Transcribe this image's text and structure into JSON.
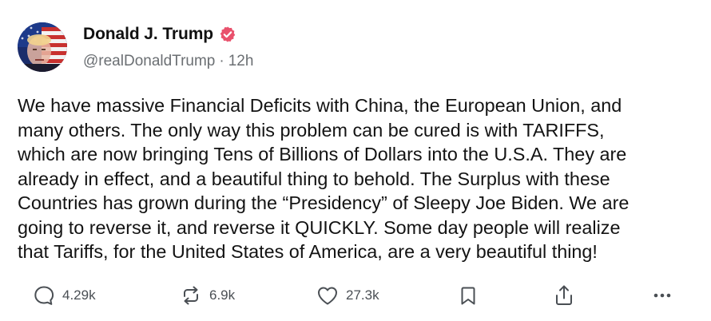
{
  "post": {
    "author": {
      "display_name": "Donald J. Trump",
      "handle": "@realDonaldTrump",
      "separator": "·",
      "time_ago": "12h",
      "verified": true
    },
    "text": "We have massive Financial Deficits with China, the European Union, and\nmany others. The only way this problem can be cured is with TARIFFS,\nwhich are now bringing Tens of Billions of Dollars into the U.S.A. They are\nalready in effect, and a beautiful thing to behold. The Surplus with these\nCountries has grown during the “Presidency” of Sleepy Joe Biden. We are\ngoing to reverse it, and reverse it QUICKLY. Some day people will realize\nthat Tariffs, for the United States of America, are a very beautiful thing!",
    "actions": {
      "replies": {
        "icon": "reply-icon",
        "count": "4.29k"
      },
      "reposts": {
        "icon": "repost-icon",
        "count": "6.9k"
      },
      "likes": {
        "icon": "heart-icon",
        "count": "27.3k"
      },
      "bookmark": {
        "icon": "bookmark-icon"
      },
      "share": {
        "icon": "share-icon"
      },
      "more": {
        "icon": "more-icon"
      }
    }
  },
  "colors": {
    "verified_badge": "#e9516c",
    "text": "#131313",
    "muted": "#6b6f73",
    "icon": "#4a4f54"
  }
}
